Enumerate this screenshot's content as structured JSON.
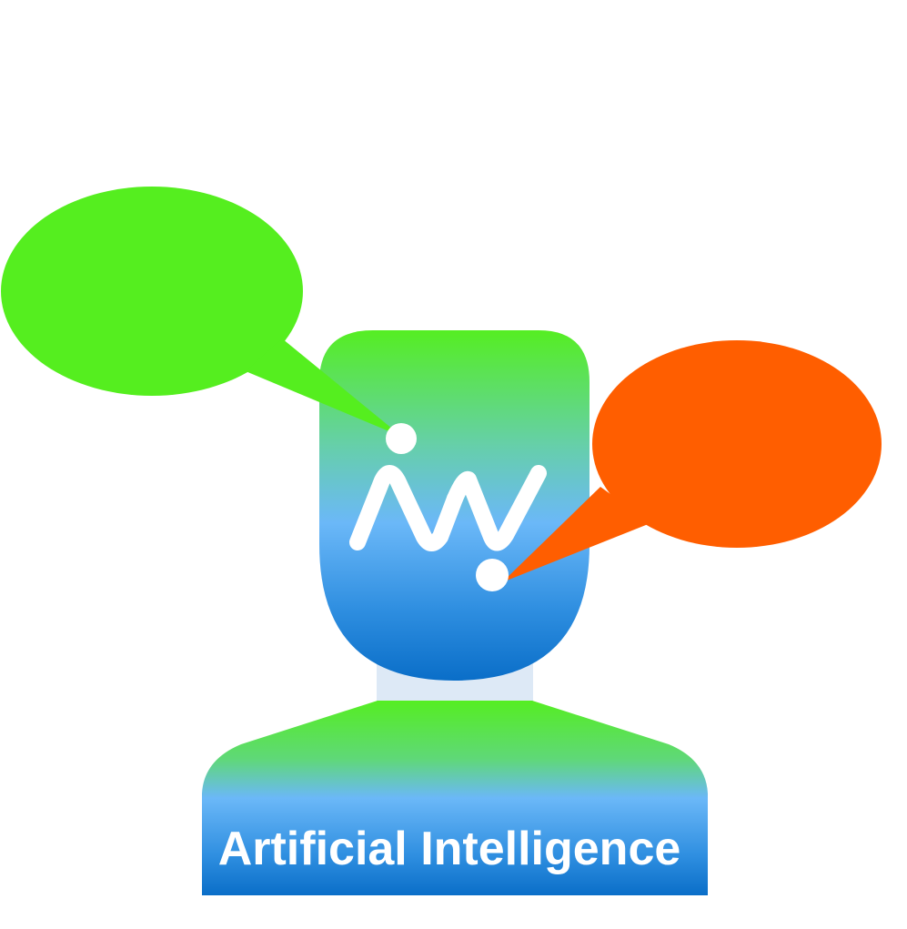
{
  "caption": {
    "text": "Artificial Intelligence"
  },
  "logo": {
    "icon": "ai-monogram-logo",
    "color": "#ffffff"
  },
  "bubbles": {
    "left": {
      "icon": "speech-bubble-icon",
      "color": "#55ee1f"
    },
    "right": {
      "icon": "speech-bubble-icon",
      "color": "#ff5e00"
    }
  },
  "figure": {
    "icon": "person-silhouette-icon",
    "gradient": [
      "#55ee22",
      "#66c6b0",
      "#6bb8f8",
      "#1a78d2",
      "#0a6ec8"
    ],
    "neck_color": "#dde9f6"
  }
}
